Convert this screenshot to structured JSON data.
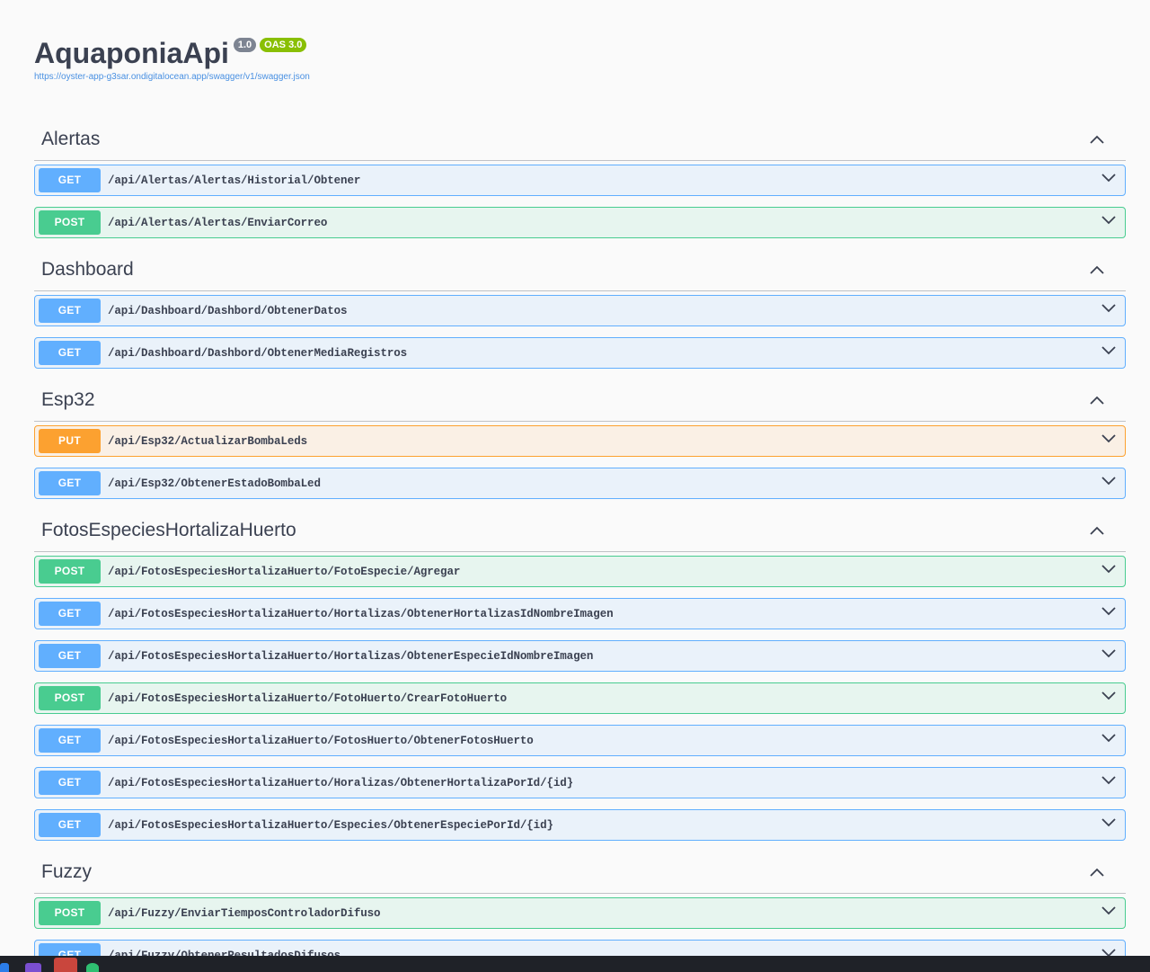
{
  "header": {
    "title": "AquaponiaApi",
    "version_badge": "1.0",
    "oas_badge": "OAS 3.0",
    "spec_url": "https://oyster-app-g3sar.ondigitalocean.app/swagger/v1/swagger.json"
  },
  "colors": {
    "get": "#61affe",
    "post": "#49cc90",
    "put": "#fca130",
    "link": "#4990e2",
    "text": "#3b4151"
  },
  "sections": [
    {
      "name": "Alertas",
      "operations": [
        {
          "method": "GET",
          "path": "/api/Alertas/Alertas/Historial/Obtener"
        },
        {
          "method": "POST",
          "path": "/api/Alertas/Alertas/EnviarCorreo"
        }
      ]
    },
    {
      "name": "Dashboard",
      "operations": [
        {
          "method": "GET",
          "path": "/api/Dashboard/Dashbord/ObtenerDatos"
        },
        {
          "method": "GET",
          "path": "/api/Dashboard/Dashbord/ObtenerMediaRegistros"
        }
      ]
    },
    {
      "name": "Esp32",
      "operations": [
        {
          "method": "PUT",
          "path": "/api/Esp32/ActualizarBombaLeds"
        },
        {
          "method": "GET",
          "path": "/api/Esp32/ObtenerEstadoBombaLed"
        }
      ]
    },
    {
      "name": "FotosEspeciesHortalizaHuerto",
      "operations": [
        {
          "method": "POST",
          "path": "/api/FotosEspeciesHortalizaHuerto/FotoEspecie/Agregar"
        },
        {
          "method": "GET",
          "path": "/api/FotosEspeciesHortalizaHuerto/Hortalizas/ObtenerHortalizasIdNombreImagen"
        },
        {
          "method": "GET",
          "path": "/api/FotosEspeciesHortalizaHuerto/Hortalizas/ObtenerEspecieIdNombreImagen"
        },
        {
          "method": "POST",
          "path": "/api/FotosEspeciesHortalizaHuerto/FotoHuerto/CrearFotoHuerto"
        },
        {
          "method": "GET",
          "path": "/api/FotosEspeciesHortalizaHuerto/FotosHuerto/ObtenerFotosHuerto"
        },
        {
          "method": "GET",
          "path": "/api/FotosEspeciesHortalizaHuerto/Horalizas/ObtenerHortalizaPorId/{id}"
        },
        {
          "method": "GET",
          "path": "/api/FotosEspeciesHortalizaHuerto/Especies/ObtenerEspeciePorId/{id}"
        }
      ]
    },
    {
      "name": "Fuzzy",
      "operations": [
        {
          "method": "POST",
          "path": "/api/Fuzzy/EnviarTiemposControladorDifuso"
        },
        {
          "method": "GET",
          "path": "/api/Fuzzy/ObtenerResultadosDifusos"
        }
      ]
    }
  ],
  "icons": {
    "section_toggle": "chevron-up-icon",
    "operation_toggle": "chevron-down-icon"
  }
}
